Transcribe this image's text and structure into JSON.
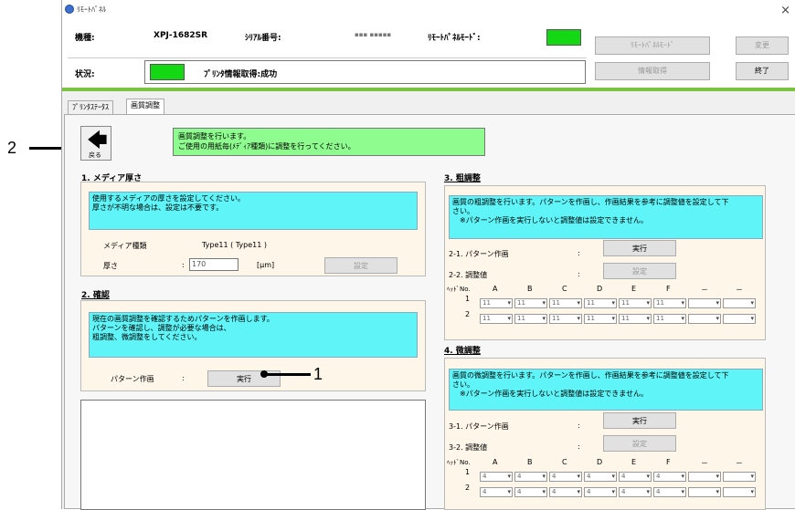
{
  "window": {
    "title": "ﾘﾓｰﾄﾊﾟﾈﾙ",
    "close_glyph": "×"
  },
  "header": {
    "model_label": "機種:",
    "model_value": "XPJ-1682SR",
    "serial_label": "ｼﾘｱﾙ番号:",
    "serial_value": "▪▪▪ ▪▪▪▪▪",
    "remote_mode_label": "ﾘﾓｰﾄﾊﾟﾈﾙﾓｰﾄﾞ:",
    "status_label": "状況:",
    "status_text": "ﾌﾟﾘﾝﾀ情報取得:成功",
    "btn_remote_mode": "ﾘﾓｰﾄﾊﾟﾈﾙﾓｰﾄﾞ",
    "btn_change": "変更",
    "btn_info": "情報取得",
    "btn_exit": "終了",
    "indicator_color": "#15d815"
  },
  "tabs": [
    "ﾌﾟﾘﾝﾀｽﾃｰﾀｽ",
    "画質調整"
  ],
  "intro": {
    "back_label": "戻る",
    "line1": "画質調整を行います。",
    "line2": "ご使用の用紙毎(ﾒﾃﾞｨｱ種類)に調整を行ってください。"
  },
  "media": {
    "title": "1. メディア厚さ",
    "desc1": "使用するメディアの厚さを設定してください。",
    "desc2": "厚さが不明な場合は、設定は不要です。",
    "type_label": "メディア種類",
    "type_value": "Type11 ( Type11 )",
    "thick_label": "厚さ",
    "colon": ":",
    "thick_value": "170",
    "unit": "[μm]",
    "set_button": "設定"
  },
  "confirm": {
    "title": "2. 確認",
    "desc1": "現在の画質調整を確認するためパターンを作画します。",
    "desc2": "パターンを確認し、調整が必要な場合は、",
    "desc3": "粗調整、微調整をしてください。",
    "pattern_label": "パターン作画",
    "colon": ":",
    "run_button": "実行"
  },
  "coarse": {
    "title": "3. 粗調整",
    "desc1": "画質の粗調整を行います。パターンを作画し、作画結果を参考に調整値を設定して下",
    "desc2": "さい。",
    "desc3": "※パターン作画を実行しないと調整値は設定できません。",
    "pattern_label": "2-1. パターン作画",
    "colon": ":",
    "run_button": "実行",
    "adjust_label": "2-2. 調整値",
    "set_button": "設定",
    "head_label": "ﾍｯﾄﾞNo.",
    "columns": [
      "A",
      "B",
      "C",
      "D",
      "E",
      "F",
      "－",
      "－"
    ],
    "rows": [
      {
        "no": "1",
        "values": [
          "11",
          "11",
          "11",
          "11",
          "11",
          "11",
          "",
          ""
        ]
      },
      {
        "no": "2",
        "values": [
          "11",
          "11",
          "11",
          "11",
          "11",
          "11",
          "",
          ""
        ]
      }
    ]
  },
  "fine": {
    "title": "4. 微調整",
    "desc1": "画質の微調整を行います。パターンを作画し、作画結果を参考に調整値を設定して下",
    "desc2": "さい。",
    "desc3": "※パターン作画を実行しないと調整値は設定できません。",
    "pattern_label": "3-1. パターン作画",
    "colon": ":",
    "run_button": "実行",
    "adjust_label": "3-2. 調整値",
    "set_button": "設定",
    "head_label": "ﾍｯﾄﾞNo.",
    "columns": [
      "A",
      "B",
      "C",
      "D",
      "E",
      "F",
      "－",
      "－"
    ],
    "rows": [
      {
        "no": "1",
        "values": [
          "4",
          "4",
          "4",
          "4",
          "4",
          "4",
          "",
          ""
        ]
      },
      {
        "no": "2",
        "values": [
          "4",
          "4",
          "4",
          "4",
          "4",
          "4",
          "",
          ""
        ]
      }
    ]
  },
  "annotations": {
    "one": "1",
    "two": "2"
  }
}
